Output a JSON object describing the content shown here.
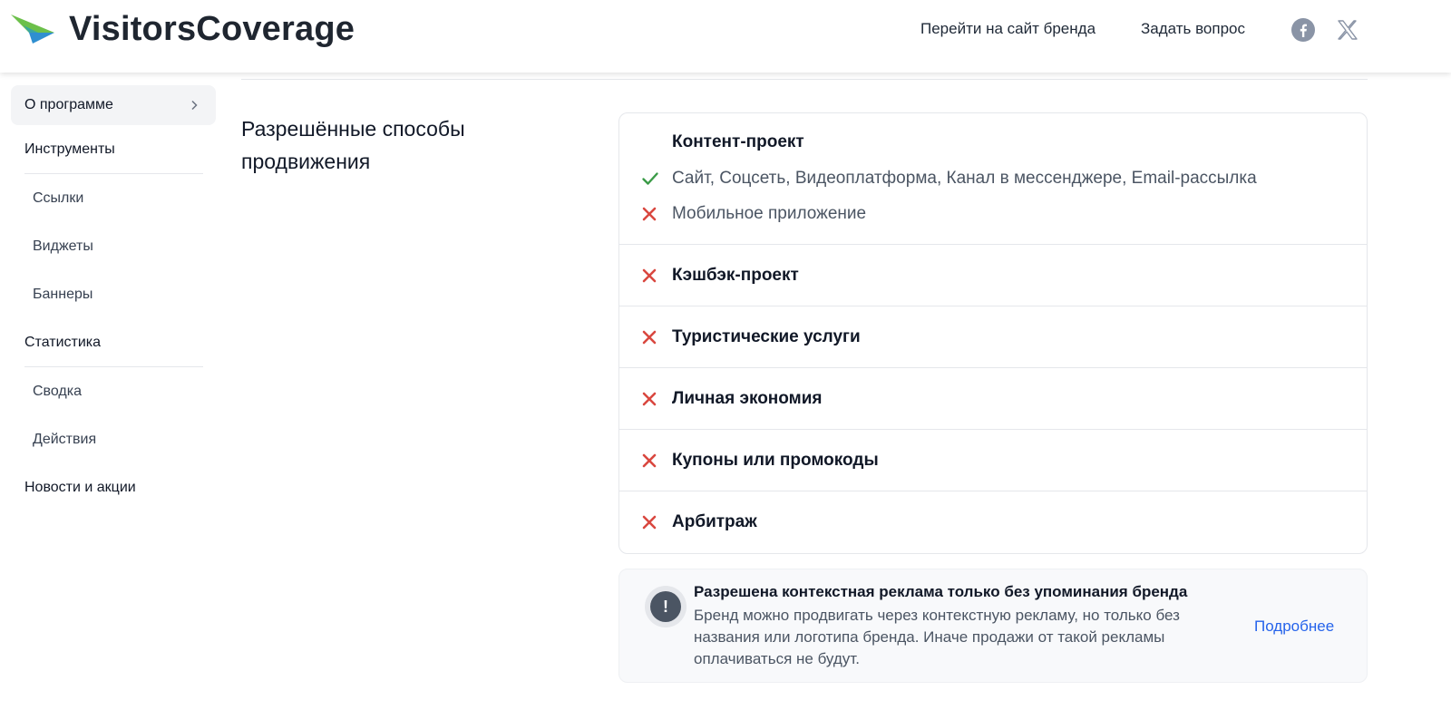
{
  "header": {
    "logo_text": "VisitorsCoverage",
    "nav": {
      "brand_site": "Перейти на сайт бренда",
      "ask_question": "Задать вопрос"
    },
    "social_icons": [
      "facebook-icon",
      "x-twitter-icon"
    ]
  },
  "sidebar": {
    "active": "О программе",
    "groups": [
      {
        "label": "Инструменты",
        "items": [
          "Ссылки",
          "Виджеты",
          "Баннеры"
        ]
      },
      {
        "label": "Статистика",
        "items": [
          "Сводка",
          "Действия"
        ]
      },
      {
        "label": "Новости и акции",
        "items": []
      }
    ]
  },
  "section": {
    "title": "Разрешённые способы продвижения"
  },
  "promotion": {
    "content_project": {
      "title": "Контент-проект",
      "allowed": "Сайт, Соцсеть, Видеоплатформа, Канал в мессенджере, Email-рассылка",
      "denied": "Мобильное приложение"
    },
    "rows": [
      {
        "label": "Кэшбэк-проект",
        "allowed": false
      },
      {
        "label": "Туристические услуги",
        "allowed": false
      },
      {
        "label": "Личная экономия",
        "allowed": false
      },
      {
        "label": "Купоны или промокоды",
        "allowed": false
      },
      {
        "label": "Арбитраж",
        "allowed": false
      }
    ]
  },
  "notice": {
    "icon": "!",
    "title": "Разрешена контекстная реклама только без упоминания бренда",
    "body": "Бренд можно продвигать через контекстную рекламу, но только без названия или логотипа бренда. Иначе продажи от такой рекламы оплачиваться не будут.",
    "more_link": "Подробнее"
  },
  "colors": {
    "allowed": "#3a9b47",
    "denied": "#d9473f",
    "link": "#2563eb"
  }
}
